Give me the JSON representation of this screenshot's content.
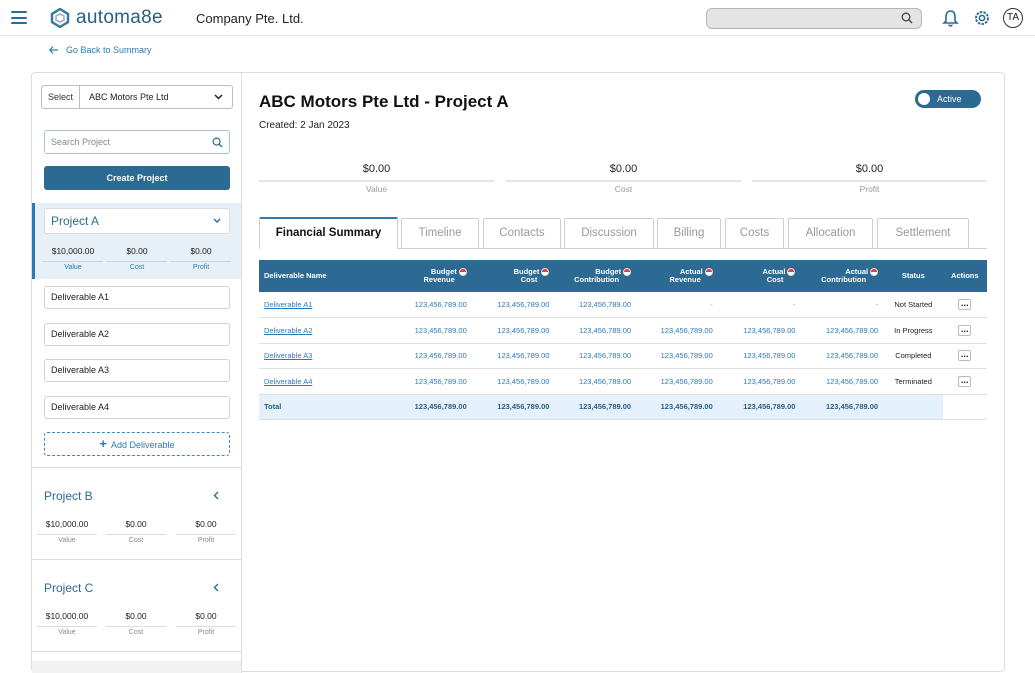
{
  "header": {
    "brand": "automa8e",
    "company": "Company Pte. Ltd.",
    "avatar_initials": "TA"
  },
  "back_link": "Go Back to Summary",
  "sidebar": {
    "select_label": "Select",
    "select_value": "ABC Motors Pte Ltd",
    "search_placeholder": "Search Project",
    "create_button": "Create Project",
    "projects": [
      {
        "name": "Project A",
        "value": "$10,000.00",
        "cost": "$0.00",
        "profit": "$0.00",
        "value_label": "Value",
        "cost_label": "Cost",
        "profit_label": "Profit"
      },
      {
        "name": "Project B",
        "value": "$10,000.00",
        "cost": "$0.00",
        "profit": "$0.00",
        "value_label": "Value",
        "cost_label": "Cost",
        "profit_label": "Profit"
      },
      {
        "name": "Project C",
        "value": "$10,000.00",
        "cost": "$0.00",
        "profit": "$0.00",
        "value_label": "Value",
        "cost_label": "Cost",
        "profit_label": "Profit"
      }
    ],
    "deliverables": [
      "Deliverable A1",
      "Deliverable A2",
      "Deliverable A3",
      "Deliverable A4"
    ],
    "add_deliverable": "Add Deliverable"
  },
  "main": {
    "title": "ABC Motors Pte Ltd - Project A",
    "created": "Created: 2 Jan 2023",
    "status_toggle": "Active",
    "summary": [
      {
        "value": "$0.00",
        "label": "Value"
      },
      {
        "value": "$0.00",
        "label": "Cost"
      },
      {
        "value": "$0.00",
        "label": "Profit"
      }
    ],
    "tabs": [
      "Financial Summary",
      "Timeline",
      "Contacts",
      "Discussion",
      "Billing",
      "Costs",
      "Allocation",
      "Settlement"
    ],
    "table": {
      "headers": {
        "name": "Deliverable Name",
        "budget_revenue": [
          "Budget",
          "Revenue"
        ],
        "budget_cost": [
          "Budget",
          "Cost"
        ],
        "budget_contribution": [
          "Budget",
          "Contribution"
        ],
        "actual_revenue": [
          "Actual",
          "Revenue"
        ],
        "actual_cost": [
          "Actual",
          "Cost"
        ],
        "actual_contribution": [
          "Actual",
          "Contribution"
        ],
        "status": "Status",
        "actions": "Actions"
      },
      "rows": [
        {
          "name": "Deliverable A1",
          "br": "123,456,789.00",
          "bc": "123,456,789.00",
          "bco": "123,456,789.00",
          "ar": "-",
          "ac": "-",
          "aco": "-",
          "status": "Not Started"
        },
        {
          "name": "Deliverable A2",
          "br": "123,456,789.00",
          "bc": "123,456,789.00",
          "bco": "123,456,789.00",
          "ar": "123,456,789.00",
          "ac": "123,456,789.00",
          "aco": "123,456,789.00",
          "status": "In Progress"
        },
        {
          "name": "Deliverable A3",
          "br": "123,456,789.00",
          "bc": "123,456,789.00",
          "bco": "123,456,789.00",
          "ar": "123,456,789.00",
          "ac": "123,456,789.00",
          "aco": "123,456,789.00",
          "status": "Completed"
        },
        {
          "name": "Deliverable A4",
          "br": "123,456,789.00",
          "bc": "123,456,789.00",
          "bco": "123,456,789.00",
          "ar": "123,456,789.00",
          "ac": "123,456,789.00",
          "aco": "123,456,789.00",
          "status": "Terminated"
        }
      ],
      "total": {
        "label": "Total",
        "br": "123,456,789.00",
        "bc": "123,456,789.00",
        "bco": "123,456,789.00",
        "ar": "123,456,789.00",
        "ac": "123,456,789.00",
        "aco": "123,456,789.00"
      },
      "actions_glyph": "..."
    }
  },
  "colors": {
    "primary": "#2d6a93",
    "link": "#2c7ab5",
    "total_row": "#e5f1fa"
  }
}
